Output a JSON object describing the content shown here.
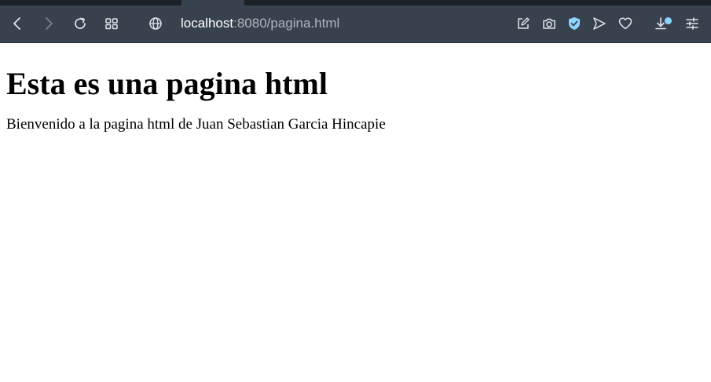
{
  "browser": {
    "url_host": "localhost",
    "url_rest": ":8080/pagina.html",
    "accent": "#8fd4ff",
    "toolbar_color": "#38424e",
    "icons": [
      "back-icon",
      "forward-icon",
      "reload-icon",
      "grid-icon",
      "globe-icon",
      "edit-share-icon",
      "camera-icon",
      "shield-icon",
      "send-icon",
      "heart-icon",
      "download-icon",
      "sliders-icon"
    ]
  },
  "page": {
    "heading": "Esta es una pagina html",
    "paragraph": "Bienvenido a la pagina html de Juan Sebastian Garcia Hincapie"
  }
}
